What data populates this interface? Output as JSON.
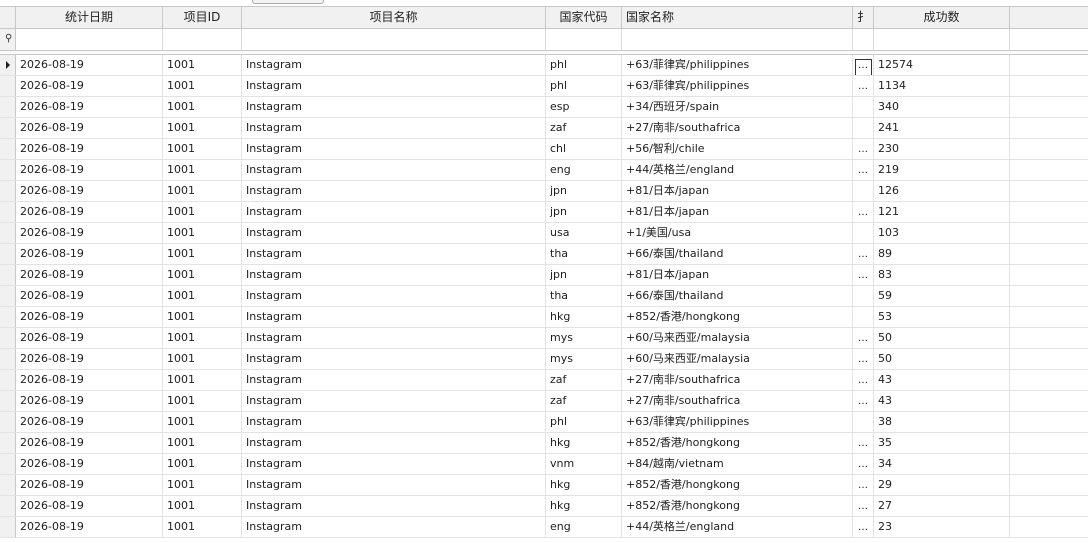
{
  "columns": [
    "统计日期",
    "项目ID",
    "项目名称",
    "国家代码",
    "国家名称",
    "扌",
    "成功数"
  ],
  "filter_icon": "pin-icon",
  "ellipsis": "…",
  "rows": [
    {
      "date": "2026-08-19",
      "pid": "1001",
      "pname": "Instagram",
      "code": "phl",
      "country": "+63/菲律宾/philippines",
      "ext": "…",
      "count": "12574"
    },
    {
      "date": "2026-08-19",
      "pid": "1001",
      "pname": "Instagram",
      "code": "phl",
      "country": "+63/菲律宾/philippines",
      "ext": "…",
      "count": "1134"
    },
    {
      "date": "2026-08-19",
      "pid": "1001",
      "pname": "Instagram",
      "code": "esp",
      "country": "+34/西班牙/spain",
      "ext": "",
      "count": "340"
    },
    {
      "date": "2026-08-19",
      "pid": "1001",
      "pname": "Instagram",
      "code": "zaf",
      "country": "+27/南非/southafrica",
      "ext": "",
      "count": "241"
    },
    {
      "date": "2026-08-19",
      "pid": "1001",
      "pname": "Instagram",
      "code": "chl",
      "country": "+56/智利/chile",
      "ext": "…",
      "count": "230"
    },
    {
      "date": "2026-08-19",
      "pid": "1001",
      "pname": "Instagram",
      "code": "eng",
      "country": "+44/英格兰/england",
      "ext": "…",
      "count": "219"
    },
    {
      "date": "2026-08-19",
      "pid": "1001",
      "pname": "Instagram",
      "code": "jpn",
      "country": "+81/日本/japan",
      "ext": "",
      "count": "126"
    },
    {
      "date": "2026-08-19",
      "pid": "1001",
      "pname": "Instagram",
      "code": "jpn",
      "country": "+81/日本/japan",
      "ext": "…",
      "count": "121"
    },
    {
      "date": "2026-08-19",
      "pid": "1001",
      "pname": "Instagram",
      "code": "usa",
      "country": "+1/美国/usa",
      "ext": "",
      "count": "103"
    },
    {
      "date": "2026-08-19",
      "pid": "1001",
      "pname": "Instagram",
      "code": "tha",
      "country": "+66/泰国/thailand",
      "ext": "…",
      "count": "89"
    },
    {
      "date": "2026-08-19",
      "pid": "1001",
      "pname": "Instagram",
      "code": "jpn",
      "country": "+81/日本/japan",
      "ext": "…",
      "count": "83"
    },
    {
      "date": "2026-08-19",
      "pid": "1001",
      "pname": "Instagram",
      "code": "tha",
      "country": "+66/泰国/thailand",
      "ext": "",
      "count": "59"
    },
    {
      "date": "2026-08-19",
      "pid": "1001",
      "pname": "Instagram",
      "code": "hkg",
      "country": "+852/香港/hongkong",
      "ext": "",
      "count": "53"
    },
    {
      "date": "2026-08-19",
      "pid": "1001",
      "pname": "Instagram",
      "code": "mys",
      "country": "+60/马来西亚/malaysia",
      "ext": "…",
      "count": "50"
    },
    {
      "date": "2026-08-19",
      "pid": "1001",
      "pname": "Instagram",
      "code": "mys",
      "country": "+60/马来西亚/malaysia",
      "ext": "…",
      "count": "50"
    },
    {
      "date": "2026-08-19",
      "pid": "1001",
      "pname": "Instagram",
      "code": "zaf",
      "country": "+27/南非/southafrica",
      "ext": "…",
      "count": "43"
    },
    {
      "date": "2026-08-19",
      "pid": "1001",
      "pname": "Instagram",
      "code": "zaf",
      "country": "+27/南非/southafrica",
      "ext": "…",
      "count": "43"
    },
    {
      "date": "2026-08-19",
      "pid": "1001",
      "pname": "Instagram",
      "code": "phl",
      "country": "+63/菲律宾/philippines",
      "ext": "",
      "count": "38"
    },
    {
      "date": "2026-08-19",
      "pid": "1001",
      "pname": "Instagram",
      "code": "hkg",
      "country": "+852/香港/hongkong",
      "ext": "…",
      "count": "35"
    },
    {
      "date": "2026-08-19",
      "pid": "1001",
      "pname": "Instagram",
      "code": "vnm",
      "country": "+84/越南/vietnam",
      "ext": "…",
      "count": "34"
    },
    {
      "date": "2026-08-19",
      "pid": "1001",
      "pname": "Instagram",
      "code": "hkg",
      "country": "+852/香港/hongkong",
      "ext": "…",
      "count": "29"
    },
    {
      "date": "2026-08-19",
      "pid": "1001",
      "pname": "Instagram",
      "code": "hkg",
      "country": "+852/香港/hongkong",
      "ext": "…",
      "count": "27"
    },
    {
      "date": "2026-08-19",
      "pid": "1001",
      "pname": "Instagram",
      "code": "eng",
      "country": "+44/英格兰/england",
      "ext": "…",
      "count": "23"
    }
  ]
}
